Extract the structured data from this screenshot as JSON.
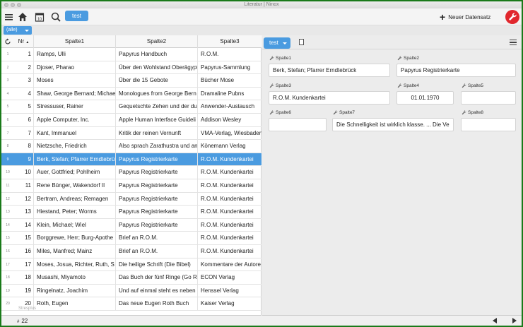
{
  "window": {
    "title": "Literatur | Ninox"
  },
  "toolbar": {
    "tab_label": "test",
    "new_record_label": "Neuer Datensatz"
  },
  "filter": {
    "label": "(alle)"
  },
  "table": {
    "headers": {
      "nr": "Nr",
      "col1": "Spalte1",
      "col2": "Spalte2",
      "col3": "Spalte3"
    },
    "rows": [
      {
        "idx": "1",
        "nr": "1",
        "c1": "Ramps, Ulli",
        "c2": "Papyrus Handbuch",
        "c3": "R.O.M."
      },
      {
        "idx": "2",
        "nr": "2",
        "c1": "Djoser, Pharao",
        "c2": "Über den Wohlstand Oberägypt",
        "c3": "Papyrus-Sammlung"
      },
      {
        "idx": "3",
        "nr": "3",
        "c1": "Moses",
        "c2": "Über die 15 Gebote",
        "c3": "Bücher Mose"
      },
      {
        "idx": "4",
        "nr": "4",
        "c1": "Shaw, George Bernard; Michae",
        "c2": "Monologues from George Bern",
        "c3": "Dramaline Pubns"
      },
      {
        "idx": "5",
        "nr": "5",
        "c1": "Stressuser, Rainer",
        "c2": "Gequetschte Zehen und der dur",
        "c3": "Anwender-Austausch"
      },
      {
        "idx": "6",
        "nr": "6",
        "c1": "Apple Computer, Inc.",
        "c2": "Apple Human Interface Guideli",
        "c3": "Addison Wesley"
      },
      {
        "idx": "7",
        "nr": "7",
        "c1": "Kant, Immanuel",
        "c2": "Kritik der reinen Vernunft",
        "c3": "VMA-Verlag, Wiesbaden"
      },
      {
        "idx": "8",
        "nr": "8",
        "c1": "Nietzsche, Friedrich",
        "c2": "Also sprach Zarathustra und an",
        "c3": "Könemann Verlag"
      },
      {
        "idx": "9",
        "nr": "9",
        "c1": "Berk, Stefan; Pfarrer Erndtebrü",
        "c2": "Papyrus Registrierkarte",
        "c3": "R.O.M. Kundenkartei"
      },
      {
        "idx": "10",
        "nr": "10",
        "c1": "Auer, Gottfried; Pohlheim",
        "c2": "Papyrus Registrierkarte",
        "c3": "R.O.M. Kundenkartei"
      },
      {
        "idx": "11",
        "nr": "11",
        "c1": "Rene Bünger, Wakendorf II",
        "c2": "Papyrus Registrierkarte",
        "c3": "R.O.M. Kundenkartei"
      },
      {
        "idx": "12",
        "nr": "12",
        "c1": "Bertram, Andreas; Remagen",
        "c2": "Papyrus Registrierkarte",
        "c3": "R.O.M. Kundenkartei"
      },
      {
        "idx": "13",
        "nr": "13",
        "c1": "Hiestand, Peter; Worms",
        "c2": "Papyrus Registrierkarte",
        "c3": "R.O.M. Kundenkartei"
      },
      {
        "idx": "14",
        "nr": "14",
        "c1": "Klein, Michael; Wiel",
        "c2": "Papyrus Registrierkarte",
        "c3": "R.O.M. Kundenkartei"
      },
      {
        "idx": "15",
        "nr": "15",
        "c1": "Borggrewe, Herr; Burg-Apothe",
        "c2": "Brief an R.O.M.",
        "c3": "R.O.M. Kundenkartei"
      },
      {
        "idx": "16",
        "nr": "16",
        "c1": "Miles, Manfred; Mainz",
        "c2": "Brief an R.O.M.",
        "c3": "R.O.M. Kundenkartei"
      },
      {
        "idx": "17",
        "nr": "17",
        "c1": "Moses, Josua, Richter, Ruth, S",
        "c2": "Die heilige Schrift (Die Bibel)",
        "c3": "Kommentare der Autore"
      },
      {
        "idx": "18",
        "nr": "18",
        "c1": "Musashi, Miyamoto",
        "c2": "Das Buch der fünf Ringe (Go R",
        "c3": "ECON Verlag"
      },
      {
        "idx": "19",
        "nr": "19",
        "c1": "Ringelnatz, Joachim",
        "c2": "Und auf einmal steht es neben",
        "c3": "Henssel Verlag"
      },
      {
        "idx": "20",
        "nr": "20",
        "c1": "Roth, Eugen",
        "c2": "Das neue Eugen Roth Buch",
        "c3": "Kaiser Verlag"
      }
    ],
    "selected_index": 8,
    "placeholder": "Stresplus",
    "footer_hash": "#",
    "footer_count": "22"
  },
  "form": {
    "tab_label": "test",
    "fields": {
      "spalte1": {
        "label": "Spalte1",
        "value": "Berk,  Stefan; Pfarrer Erndtebrück"
      },
      "spalte2": {
        "label": "Spalte2",
        "value": "Papyrus Registrierkarte"
      },
      "spalte3": {
        "label": "Spalte3",
        "value": "R.O.M. Kundenkartei"
      },
      "spalte4": {
        "label": "Spalte4",
        "value": "01.01.1970"
      },
      "spalte5": {
        "label": "Spalte5",
        "value": ""
      },
      "spalte6": {
        "label": "Spalte6",
        "value": ""
      },
      "spalte7": {
        "label": "Spalte7",
        "value": "Die Schnelligkeit ist wirklich klasse. ... Die Ve"
      },
      "spalte8": {
        "label": "Spalte8",
        "value": ""
      }
    }
  },
  "colors": {
    "accent": "#4a9be0",
    "tools_button": "#e1272d",
    "frame_border": "#1a7a1a"
  }
}
